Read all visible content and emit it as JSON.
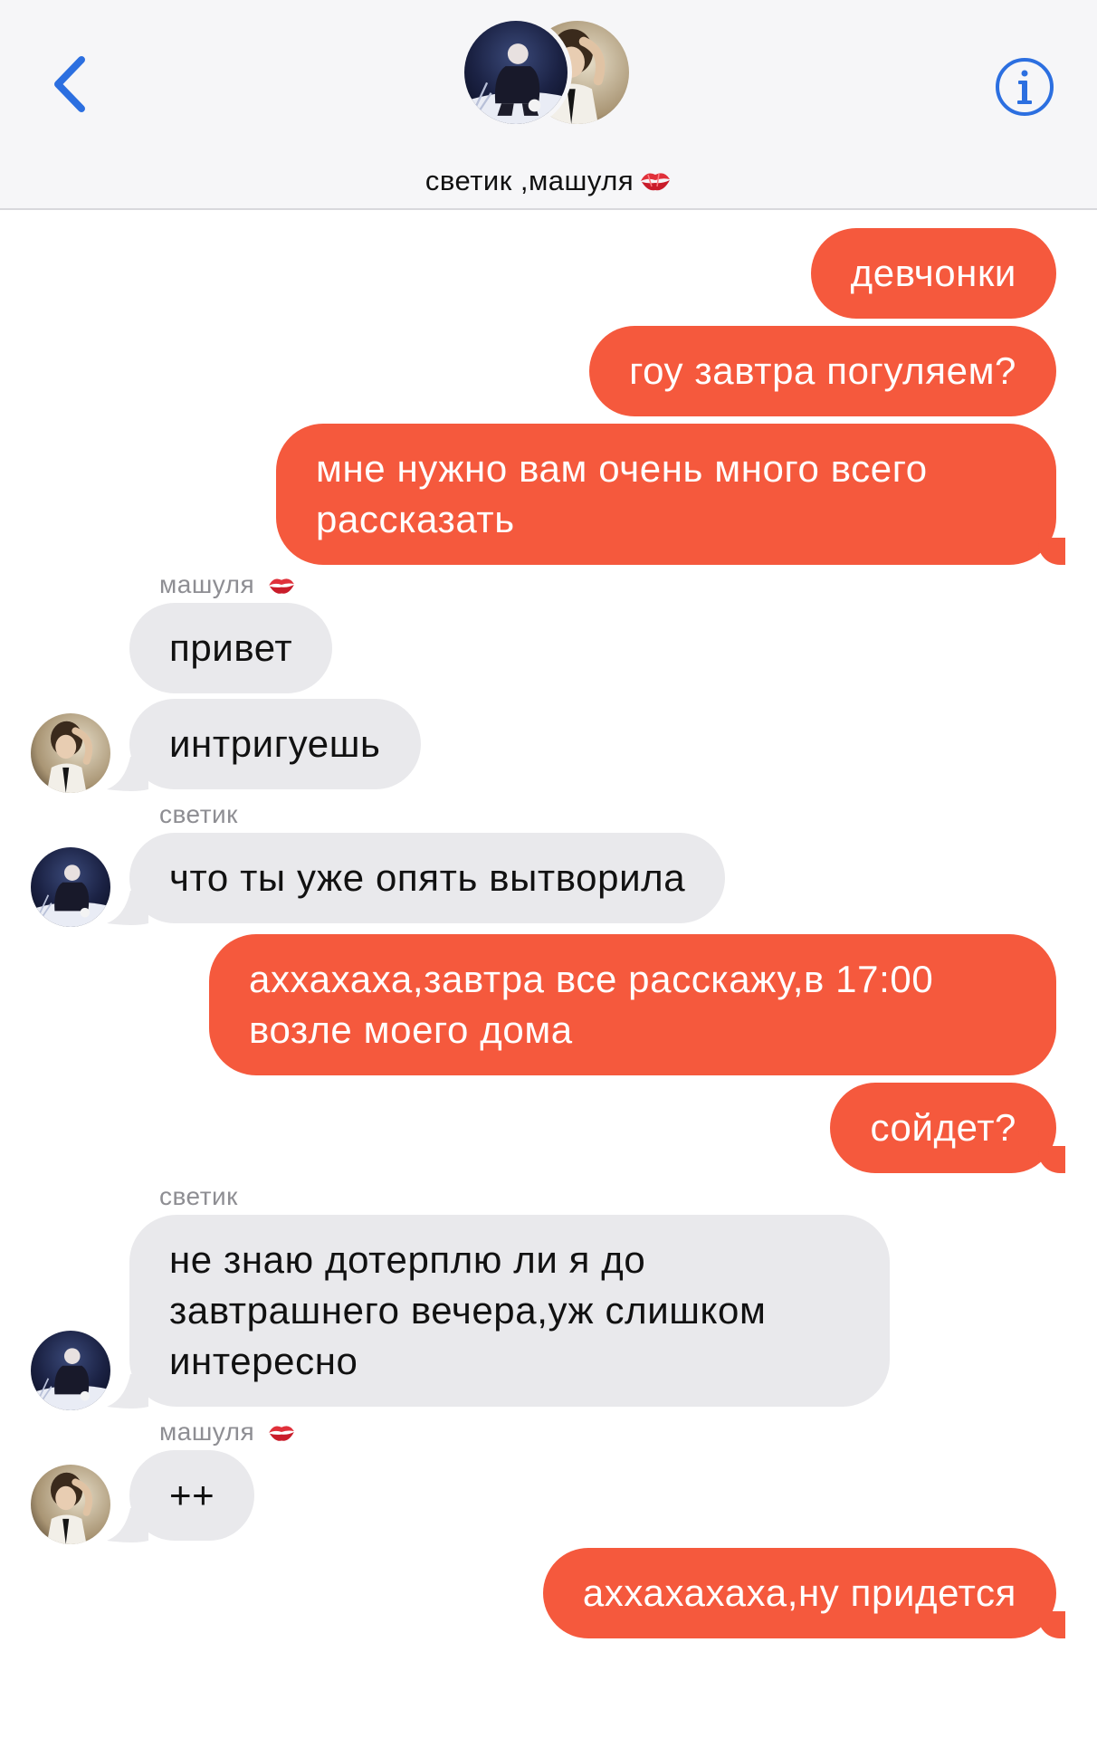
{
  "header": {
    "group_name": "светик ,машуля",
    "group_emoji": "kiss-mark-icon",
    "accent_color": "#2c6fe0"
  },
  "colors": {
    "outgoing": "#f5593d",
    "incoming": "#e9e9ec",
    "sender_label": "#8e8e93"
  },
  "messages": [
    {
      "dir": "out",
      "text": "девчонки"
    },
    {
      "dir": "out",
      "text": "гоу завтра погуляем?"
    },
    {
      "dir": "out",
      "line1": "мне нужно вам очень много всего",
      "line2": "рассказать"
    },
    {
      "dir": "in",
      "sender": "машуля",
      "text": "привет"
    },
    {
      "dir": "in",
      "sender": "машуля",
      "text": "интригуешь"
    },
    {
      "dir": "in",
      "sender": "светик",
      "text": "что ты уже опять вытворила"
    },
    {
      "dir": "out",
      "line1": "аххахаха,завтра все расскажу,в 17:00",
      "line2": "возле моего дома"
    },
    {
      "dir": "out",
      "text": "сойдет?"
    },
    {
      "dir": "in",
      "sender": "светик",
      "line1": "не знаю дотерплю ли я до",
      "line2": "завтрашнего вечера,уж слишком",
      "line3": "интересно"
    },
    {
      "dir": "in",
      "sender": "машуля",
      "text": "++"
    },
    {
      "dir": "out",
      "text": "аххахахаха,ну придется"
    }
  ]
}
